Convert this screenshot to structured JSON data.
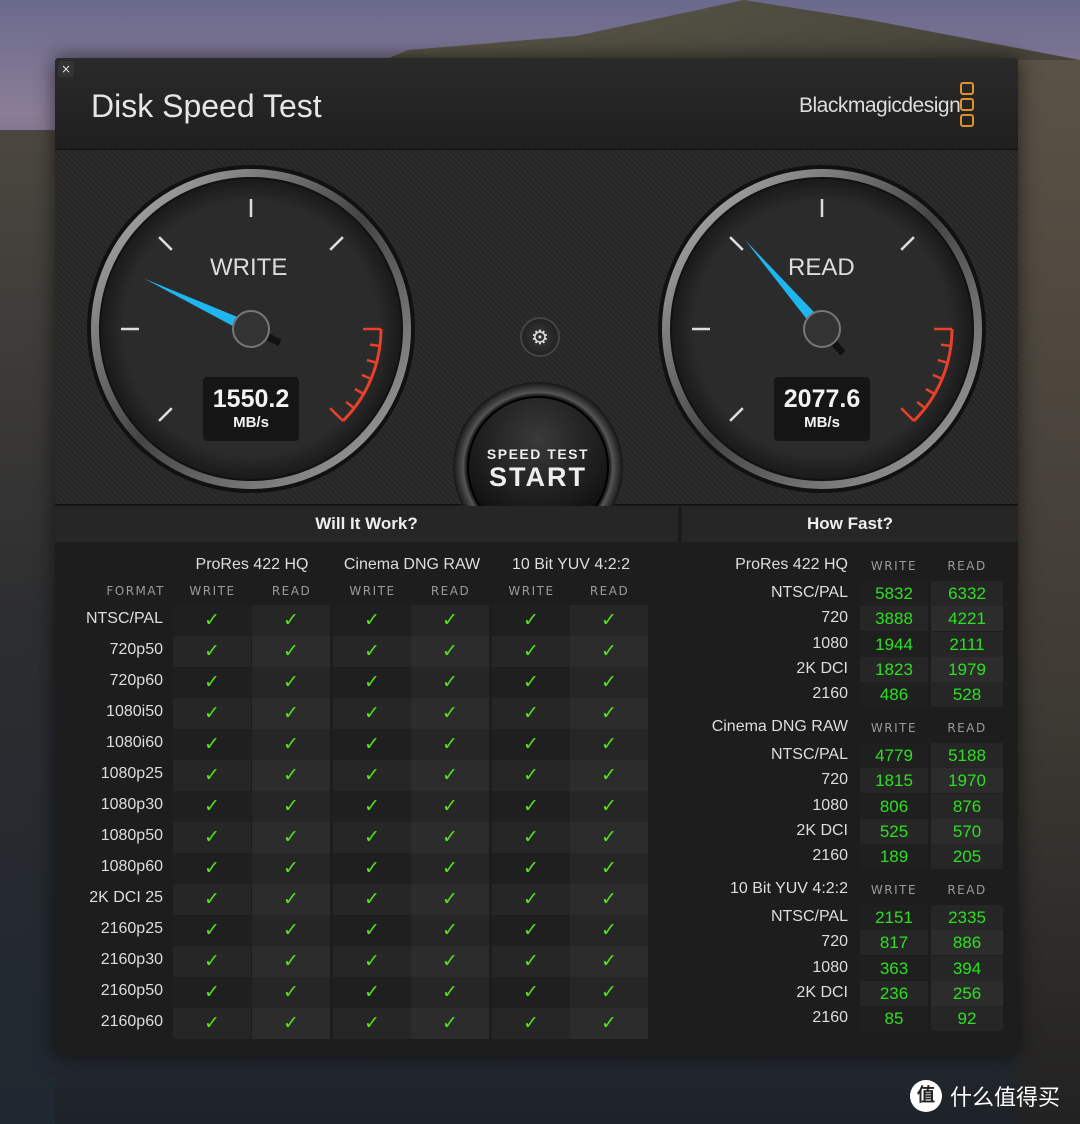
{
  "window": {
    "title": "Disk Speed Test",
    "brand": "Blackmagicdesign",
    "close_icon": "close-icon"
  },
  "gauges": {
    "write": {
      "label": "WRITE",
      "value": "1550.2",
      "unit": "MB/s"
    },
    "read": {
      "label": "READ",
      "value": "2077.6",
      "unit": "MB/s"
    }
  },
  "start_button": {
    "line1": "SPEED TEST",
    "line2": "START"
  },
  "settings_icon": "gear-icon",
  "will_it_work": {
    "title": "Will It Work?",
    "format_header": "FORMAT",
    "groups": [
      "ProRes 422 HQ",
      "Cinema DNG RAW",
      "10 Bit YUV 4:2:2"
    ],
    "subcols": [
      "WRITE",
      "READ",
      "WRITE",
      "READ",
      "WRITE",
      "READ"
    ],
    "formats": [
      "NTSC/PAL",
      "720p50",
      "720p60",
      "1080i50",
      "1080i60",
      "1080p25",
      "1080p30",
      "1080p50",
      "1080p60",
      "2K DCI 25",
      "2160p25",
      "2160p30",
      "2160p50",
      "2160p60"
    ],
    "cell_mark": "✓",
    "check_color": "#55e21f"
  },
  "how_fast": {
    "title": "How Fast?",
    "sections": [
      {
        "name": "ProRes 422 HQ",
        "write": "WRITE",
        "read": "READ",
        "rows": [
          [
            "NTSC/PAL",
            "5832",
            "6332"
          ],
          [
            "720",
            "3888",
            "4221"
          ],
          [
            "1080",
            "1944",
            "2111"
          ],
          [
            "2K DCI",
            "1823",
            "1979"
          ],
          [
            "2160",
            "486",
            "528"
          ]
        ]
      },
      {
        "name": "Cinema DNG RAW",
        "write": "WRITE",
        "read": "READ",
        "rows": [
          [
            "NTSC/PAL",
            "4779",
            "5188"
          ],
          [
            "720",
            "1815",
            "1970"
          ],
          [
            "1080",
            "806",
            "876"
          ],
          [
            "2K DCI",
            "525",
            "570"
          ],
          [
            "2160",
            "189",
            "205"
          ]
        ]
      },
      {
        "name": "10 Bit YUV 4:2:2",
        "write": "WRITE",
        "read": "READ",
        "rows": [
          [
            "NTSC/PAL",
            "2151",
            "2335"
          ],
          [
            "720",
            "817",
            "886"
          ],
          [
            "1080",
            "363",
            "394"
          ],
          [
            "2K DCI",
            "236",
            "256"
          ],
          [
            "2160",
            "85",
            "92"
          ]
        ]
      }
    ]
  },
  "colors": {
    "accent_needle": "#1fb6f0",
    "redline": "#e8402a",
    "logo": "#e0902a"
  },
  "watermark": {
    "logo": "值",
    "text": "什么值得买"
  }
}
